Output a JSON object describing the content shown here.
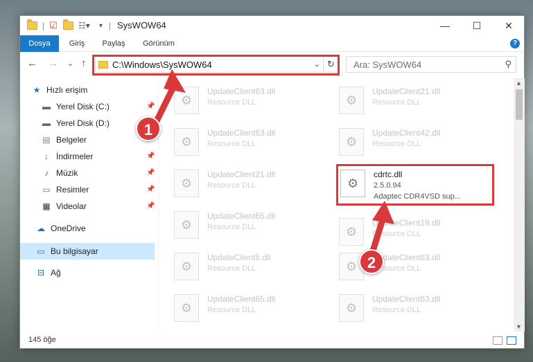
{
  "window": {
    "title": "SysWOW64",
    "controls": {
      "minimize": "—",
      "maximize": "☐",
      "close": "✕"
    }
  },
  "ribbon": {
    "tabs": [
      {
        "label": "Dosya"
      },
      {
        "label": "Giriş"
      },
      {
        "label": "Paylaş"
      },
      {
        "label": "Görünüm"
      }
    ],
    "help": "?"
  },
  "navigation": {
    "back": "←",
    "forward": "→",
    "recent": "⌄",
    "up": "↑",
    "address": "C:\\Windows\\SysWOW64",
    "search_placeholder": "Ara: SysWOW64"
  },
  "sidebar": {
    "items": [
      {
        "label": "Hızlı erişim",
        "icon": "star-icon"
      },
      {
        "label": "Yerel Disk (C:)",
        "icon": "drive-icon",
        "pinned": true
      },
      {
        "label": "Yerel Disk (D:)",
        "icon": "drive-icon",
        "pinned": true
      },
      {
        "label": "Belgeler",
        "icon": "documents-icon",
        "pinned": true
      },
      {
        "label": "İndirmeler",
        "icon": "download-icon",
        "pinned": true
      },
      {
        "label": "Müzik",
        "icon": "music-icon",
        "pinned": true
      },
      {
        "label": "Resimler",
        "icon": "pictures-icon",
        "pinned": true
      },
      {
        "label": "Videolar",
        "icon": "video-icon",
        "pinned": true
      },
      {
        "label": "OneDrive",
        "icon": "cloud-icon"
      },
      {
        "label": "Bu bilgisayar",
        "icon": "computer-icon",
        "selected": true
      },
      {
        "label": "Ağ",
        "icon": "network-icon"
      }
    ]
  },
  "files": [
    {
      "name": "UpdateClient63.dll",
      "type": "Resource DLL"
    },
    {
      "name": "UpdateClient21.dll",
      "type": "Resource DLL"
    },
    {
      "name": "UpdateClient63.dll",
      "type": "Resource DLL"
    },
    {
      "name": "UpdateClient42.dll",
      "type": "Resource DLL"
    },
    {
      "name": "UpdateClient21.dll",
      "type": "Resource DLL"
    },
    {
      "name": "cdrtc.dll",
      "version": "2.5.0.94",
      "desc": "Adaptec CDR4VSD sup...",
      "highlighted": true
    },
    {
      "name": "UpdateClient65.dll",
      "type": "Resource DLL"
    },
    {
      "name": "UpdateClient19.dll",
      "type": "Resource DLL"
    },
    {
      "name": "UpdateClient5.dll",
      "type": "Resource DLL"
    },
    {
      "name": "UpdateClient63.dll",
      "type": "Resource DLL"
    },
    {
      "name": "UpdateClient65.dll",
      "type": "Resource DLL"
    },
    {
      "name": "UpdateClient63.dll",
      "type": "Resource DLL"
    }
  ],
  "status": {
    "item_count": "145 öğe"
  },
  "annotations": {
    "step1": "1",
    "step2": "2",
    "highlight_color": "#d9393a"
  }
}
